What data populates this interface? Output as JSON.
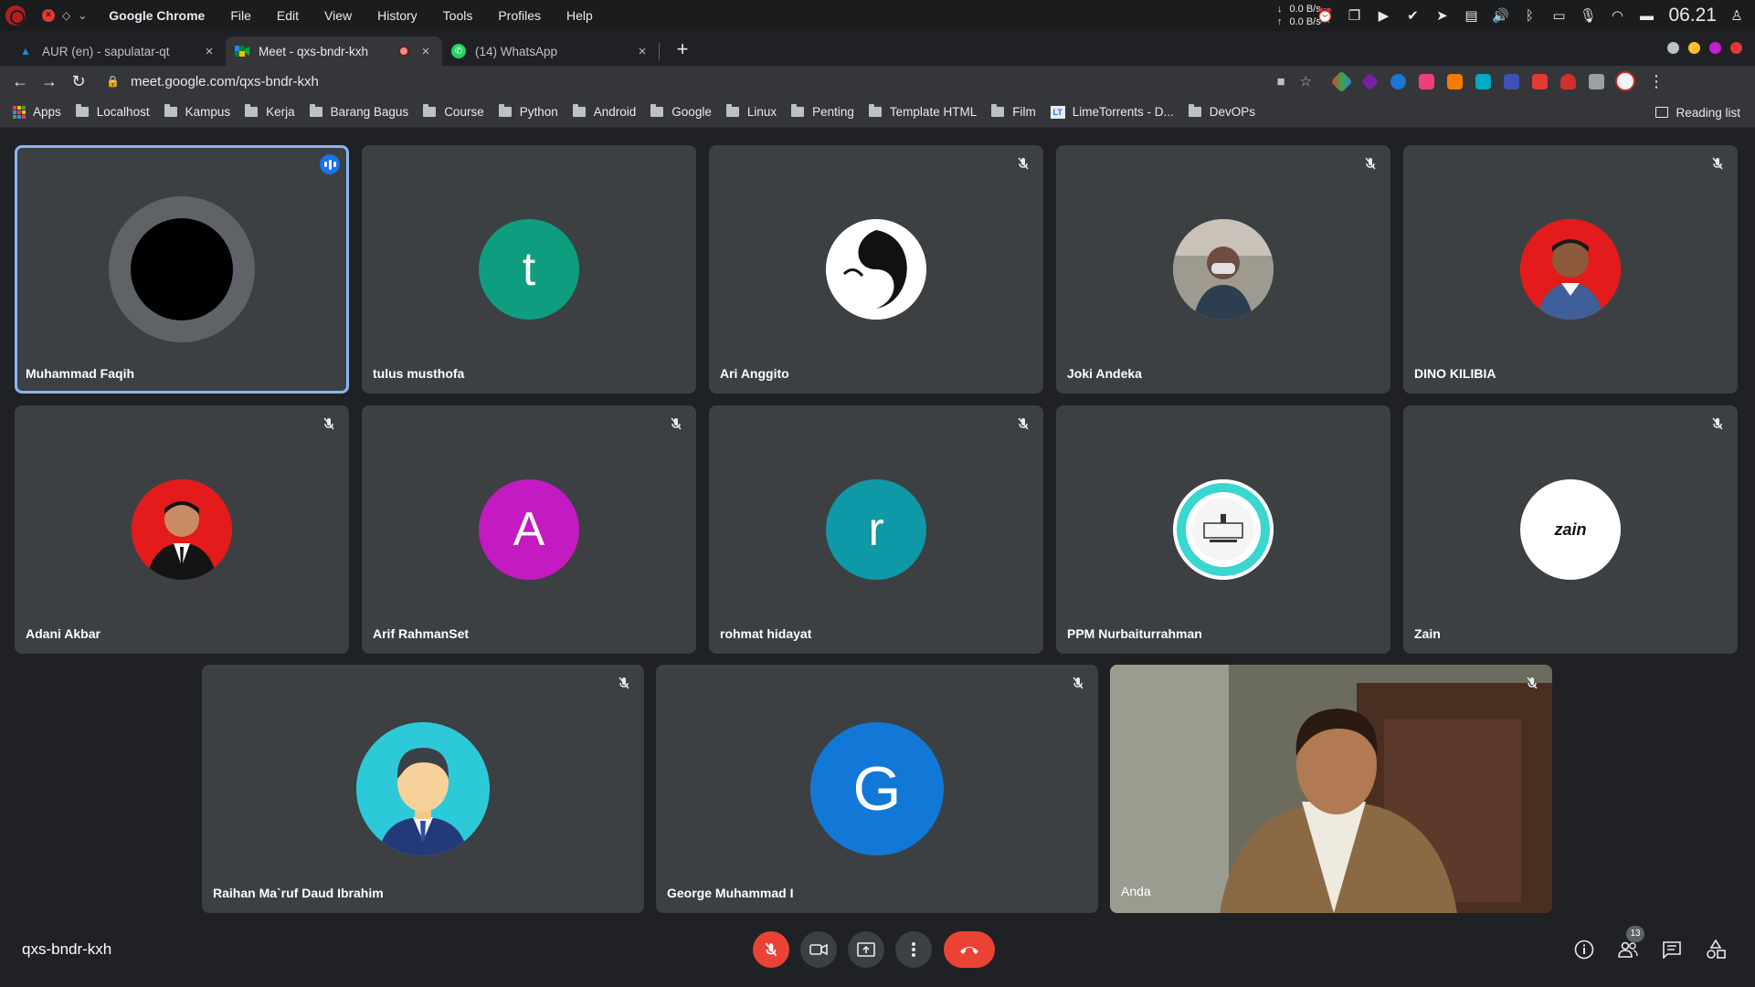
{
  "system": {
    "app_name": "Google Chrome",
    "menu": [
      "File",
      "Edit",
      "View",
      "History",
      "Tools",
      "Profiles",
      "Help"
    ],
    "net_down": "0.0 B/s",
    "net_up": "0.0 B/s",
    "net_down_arrow": "↓",
    "net_up_arrow": "↑",
    "clock": "06.21"
  },
  "tabs": [
    {
      "title": "AUR (en) - sapulatar-qt",
      "icon": "arch-icon",
      "active": false
    },
    {
      "title": "Meet - qxs-bndr-kxh",
      "icon": "meet-icon",
      "active": true,
      "recording": true
    },
    {
      "title": "(14) WhatsApp",
      "icon": "whatsapp-icon",
      "active": false
    }
  ],
  "tab_close": "×",
  "new_tab": "+",
  "toolbar": {
    "url": "meet.google.com/qxs-bndr-kxh"
  },
  "bookmarks": {
    "apps": "Apps",
    "items": [
      "Localhost",
      "Kampus",
      "Kerja",
      "Barang Bagus",
      "Course",
      "Python",
      "Android",
      "Google",
      "Linux",
      "Penting",
      "Template HTML",
      "Film"
    ],
    "lt_badge": "LT",
    "lime": "LimeTorrents - D...",
    "devops": "DevOPs",
    "reading_list": "Reading list"
  },
  "participants": [
    {
      "name": "Muhammad Faqih",
      "avatar_type": "ring",
      "speaking": true
    },
    {
      "name": "tulus musthofa",
      "initial": "t",
      "color": "#0f9d80"
    },
    {
      "name": "Ari Anggito",
      "avatar_type": "photo",
      "photo": "yin-yang-fish"
    },
    {
      "name": "Joki Andeka",
      "avatar_type": "photo",
      "photo": "masked-person"
    },
    {
      "name": "DINO KILIBIA",
      "avatar_type": "photo",
      "photo": "red-bg-person"
    },
    {
      "name": "Adani Akbar",
      "avatar_type": "photo",
      "photo": "red-bg-suit"
    },
    {
      "name": "Arif RahmanSet",
      "initial": "A",
      "color": "#c31ac1"
    },
    {
      "name": "rohmat hidayat",
      "initial": "r",
      "color": "#0f98a5"
    },
    {
      "name": "PPM Nurbaiturrahman",
      "avatar_type": "photo",
      "photo": "mosque-logo"
    },
    {
      "name": "Zain",
      "avatar_type": "logo",
      "logo_text": "zain"
    },
    {
      "name": "Raihan Ma`ruf Daud Ibrahim",
      "avatar_type": "illustration",
      "photo": "cartoon-businessman"
    },
    {
      "name": "George Muhammad I",
      "initial": "G",
      "color": "#1278d7"
    },
    {
      "name": "Anda",
      "avatar_type": "video",
      "photo": "self-camera"
    }
  ],
  "meeting": {
    "code": "qxs-bndr-kxh",
    "participant_count": "13"
  },
  "colors": {
    "background": "#202124",
    "tile": "#3c4043",
    "accent": "#8ab4f8",
    "danger": "#ea4335"
  }
}
